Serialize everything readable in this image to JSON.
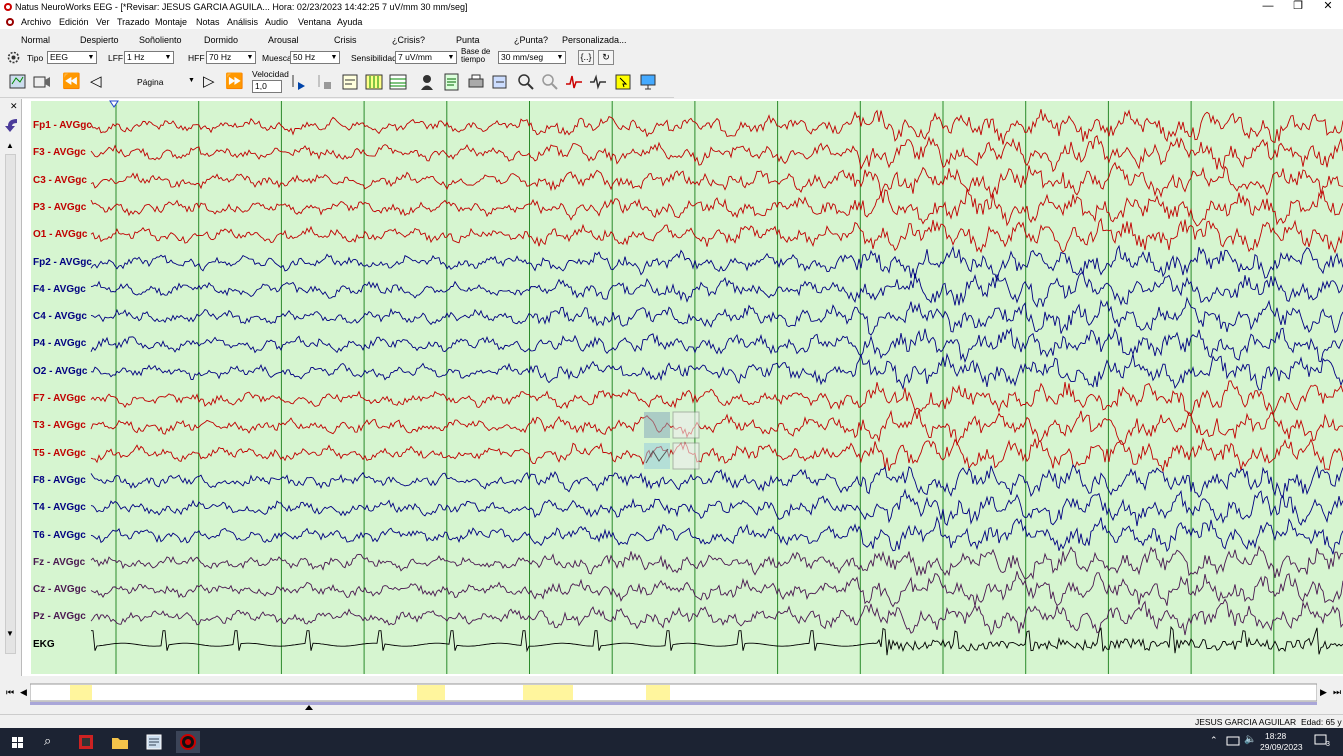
{
  "window": {
    "title": "Natus NeuroWorks EEG - [*Revisar:   JESUS  GARCIA AGUILA...   Hora: 02/23/2023 14:42:25   7 uV/mm   30 mm/seg]",
    "min_glyph": "—",
    "restore_glyph": "❐",
    "close_glyph": "✕"
  },
  "menu": [
    "Archivo",
    "Edición",
    "Ver",
    "Trazado",
    "Montaje",
    "Notas",
    "Análisis",
    "Audio",
    "Ventana",
    "Ayuda"
  ],
  "event_buttons": [
    "Normal",
    "Despierto",
    "Soñoliento",
    "Dormido",
    "Arousal",
    "Crisis",
    "¿Crisis?",
    "Punta",
    "¿Punta?",
    "Personalizada..."
  ],
  "settings": {
    "tipo_label": "Tipo",
    "tipo_value": "EEG",
    "lff_label": "LFF",
    "lff_value": "1 Hz",
    "hff_label": "HFF",
    "hff_value": "70 Hz",
    "muesca_label": "Muesca",
    "muesca_value": "50 Hz",
    "sens_label": "Sensibilidad",
    "sens_value": "7 uV/mm",
    "base_label": "Base de tiempo",
    "base_value": "30 mm/seg",
    "btn1": "{..}",
    "btn2": "↻"
  },
  "toolbar": {
    "pagina_label": "Página",
    "velocidad_label": "Velocidad",
    "velocidad_value": "1,0",
    "rewind_glyph": "⏪",
    "back_glyph": "◁",
    "fwd_glyph": "▷",
    "ffwd_glyph": "⏩"
  },
  "channels": [
    {
      "label": "Fp1 - AVGgc",
      "color": "#c00000"
    },
    {
      "label": "F3 - AVGgc",
      "color": "#c00000"
    },
    {
      "label": "C3 - AVGgc",
      "color": "#c00000"
    },
    {
      "label": "P3 - AVGgc",
      "color": "#c00000"
    },
    {
      "label": "O1 - AVGgc",
      "color": "#c00000"
    },
    {
      "label": "Fp2 - AVGgc",
      "color": "#000080"
    },
    {
      "label": "F4 - AVGgc",
      "color": "#000080"
    },
    {
      "label": "C4 - AVGgc",
      "color": "#000080"
    },
    {
      "label": "P4 - AVGgc",
      "color": "#000080"
    },
    {
      "label": "O2 - AVGgc",
      "color": "#000080"
    },
    {
      "label": "F7 - AVGgc",
      "color": "#c00000"
    },
    {
      "label": "T3 - AVGgc",
      "color": "#c00000"
    },
    {
      "label": "T5 - AVGgc",
      "color": "#c00000"
    },
    {
      "label": "F8 - AVGgc",
      "color": "#000080"
    },
    {
      "label": "T4 - AVGgc",
      "color": "#000080"
    },
    {
      "label": "T6 - AVGgc",
      "color": "#000080"
    },
    {
      "label": "Fz - AVGgc",
      "color": "#4a1850"
    },
    {
      "label": "Cz - AVGgc",
      "color": "#4a1850"
    },
    {
      "label": "Pz - AVGgc",
      "color": "#4a1850"
    },
    {
      "label": "EKG",
      "color": "#000000"
    }
  ],
  "status": {
    "patient": "JESUS  GARCIA AGUILAR",
    "age": "Edad: 65 y"
  },
  "taskbar": {
    "time": "18:28",
    "date": "29/09/2023",
    "notif_count": "3",
    "search_glyph": "⌕"
  },
  "colors": {
    "plot_bg": "#d6f5d0",
    "second_line": "#2a8a2a",
    "red_trace": "#c00000",
    "blue_trace": "#000080",
    "purple_trace": "#4a1850",
    "ekg_trace": "#000000",
    "timeline_event": "#fff59d"
  }
}
